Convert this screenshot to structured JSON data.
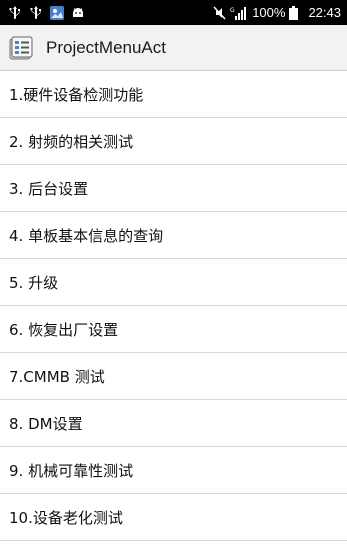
{
  "status_bar": {
    "left_icons": [
      "usb-icon",
      "usb-icon",
      "gallery-icon",
      "android-debug-icon"
    ],
    "right_icons": [
      "mute-icon",
      "signal-icon",
      "battery-icon"
    ],
    "network_label": "G",
    "battery": "100%",
    "time": "22:43"
  },
  "action_bar": {
    "icon": "app-menu-icon",
    "title": "ProjectMenuAct"
  },
  "menu": {
    "items": [
      {
        "label": "1.硬件设备检测功能"
      },
      {
        "label": "2. 射频的相关测试"
      },
      {
        "label": "3. 后台设置"
      },
      {
        "label": "4. 单板基本信息的查询"
      },
      {
        "label": "5. 升级"
      },
      {
        "label": "6. 恢复出厂设置"
      },
      {
        "label": "7.CMMB 测试"
      },
      {
        "label": "8. DM设置"
      },
      {
        "label": "9. 机械可靠性测试"
      },
      {
        "label": "10.设备老化测试"
      }
    ]
  },
  "colors": {
    "status_bar_bg": "#000000",
    "action_bar_bg": "#f2f2f2",
    "divider": "#d8d8d8",
    "text": "#111111"
  }
}
